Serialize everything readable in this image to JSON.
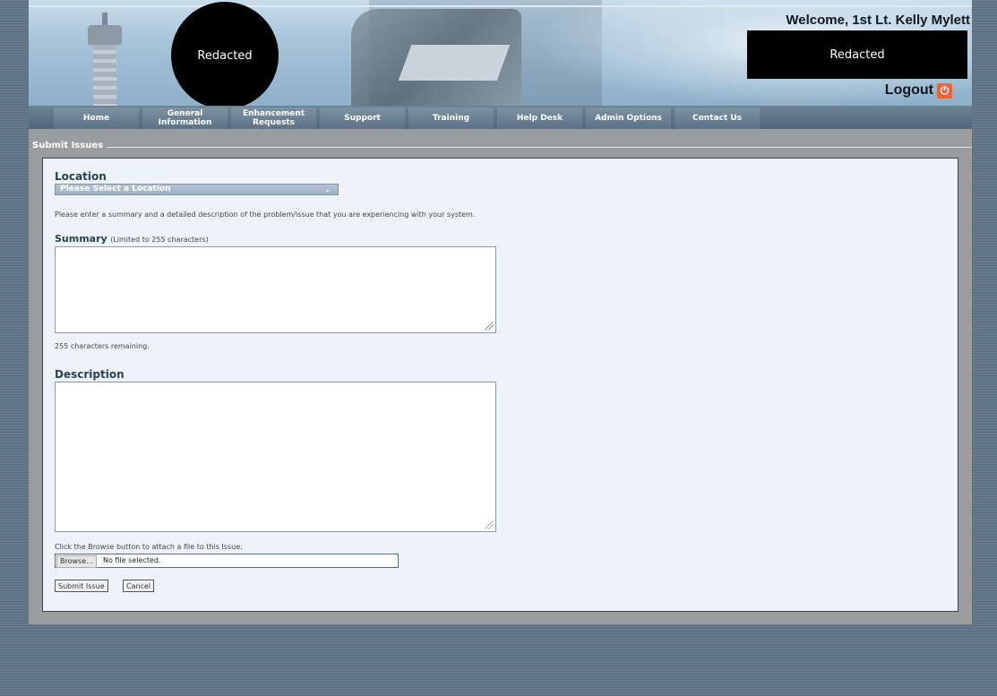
{
  "header": {
    "logo_text": "Redacted",
    "welcome": "Welcome, 1st Lt. Kelly Mylett",
    "redacted_box": "Redacted",
    "logout": "Logout"
  },
  "nav": {
    "items": [
      "Home",
      "General Information",
      "Enhancement Requests",
      "Support",
      "Training",
      "Help Desk",
      "Admin Options",
      "Contact Us"
    ]
  },
  "section": {
    "legend": "Submit Issues"
  },
  "form": {
    "location_label": "Location",
    "location_selected": "Please Select a Location",
    "instructions": "Please enter a summary and a detailed description of the problem/issue that you are experiencing with your system.",
    "summary_label": "Summary",
    "summary_hint": "(Limited to 255 characters)",
    "chars_remaining": "255 characters remaining.",
    "description_label": "Description",
    "attach_text": "Click the Browse button to attach a file to this Issue.",
    "browse_label": "Browse...",
    "file_status": "No file selected.",
    "submit_label": "Submit Issue",
    "cancel_label": "Cancel"
  },
  "colors": {
    "accent": "#2b3f57",
    "logout_icon": "#e8673f",
    "background": "#5f7386"
  }
}
